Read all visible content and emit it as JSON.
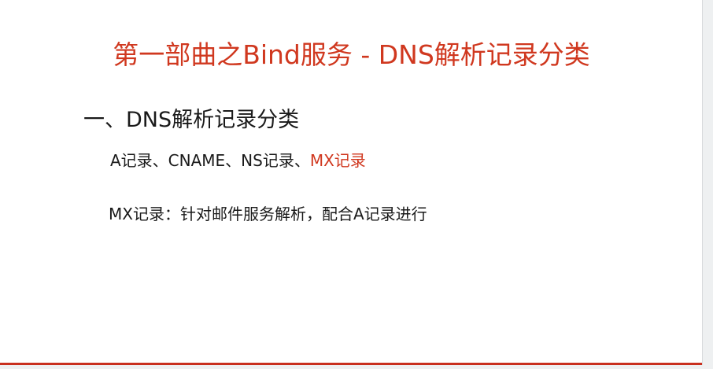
{
  "slide": {
    "title": "第一部曲之Bind服务 - DNS解析记录分类",
    "heading": "一、DNS解析记录分类",
    "record_types_plain": "A记录、CNAME、NS记录、",
    "record_types_highlight": "MX记录",
    "mx_description": "MX记录：针对邮件服务解析，配合A记录进行"
  },
  "colors": {
    "accent": "#d0381f",
    "text": "#1a1a1a",
    "background": "#ffffff"
  }
}
